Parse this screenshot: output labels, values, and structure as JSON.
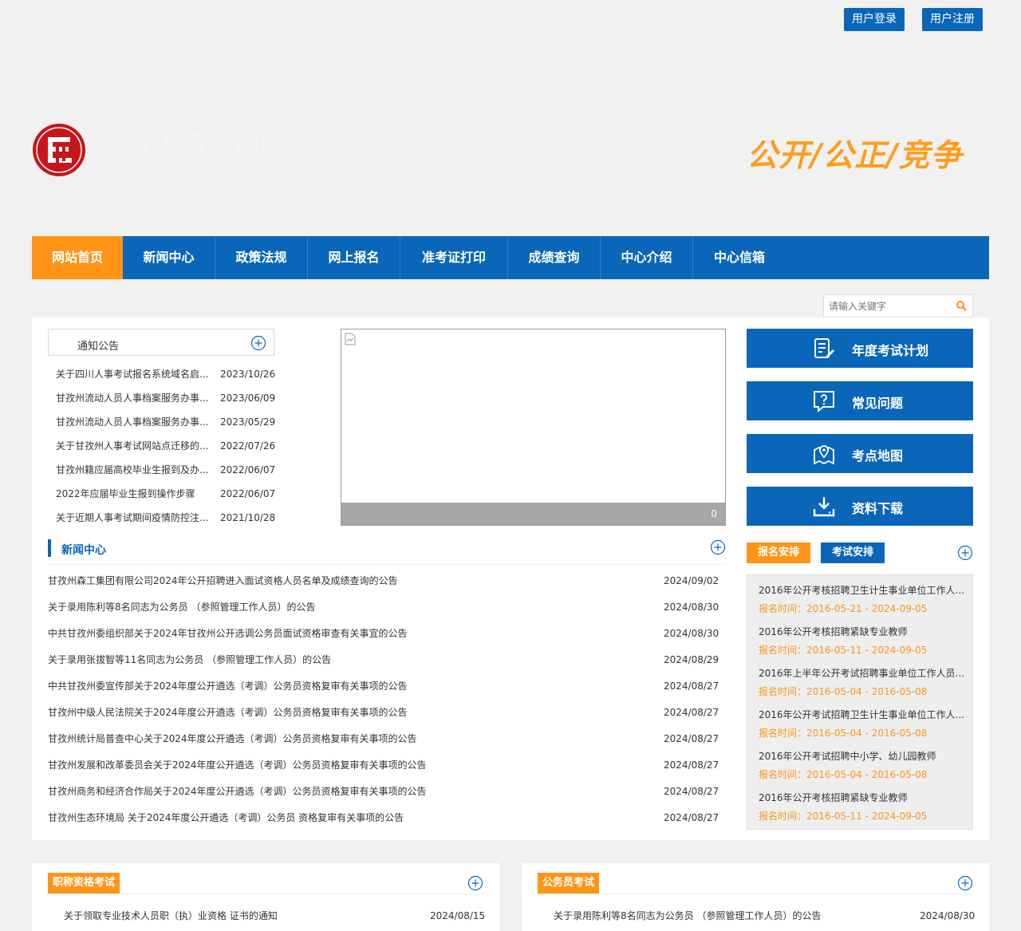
{
  "topbar": {
    "welcome": "欢迎访问甘孜人事考试网站！今天是 2024年09月06日 星期五",
    "login_label": "用户登录",
    "register_label": "用户注册"
  },
  "header": {
    "site_name": "甘孜人事考试网",
    "site_url": "http://gzzrsks.com.cn/",
    "slogan": "公开/公正/竞争",
    "logo_icon": "seal-logo-icon"
  },
  "nav": {
    "items": [
      {
        "label": "网站首页",
        "active": true
      },
      {
        "label": "新闻中心"
      },
      {
        "label": "政策法规"
      },
      {
        "label": "网上报名"
      },
      {
        "label": "准考证打印"
      },
      {
        "label": "成绩查询"
      },
      {
        "label": "中心介绍"
      },
      {
        "label": "中心信箱"
      }
    ]
  },
  "search": {
    "placeholder": "请输入关键字",
    "icon": "search-icon"
  },
  "notice": {
    "title": "通知公告",
    "items": [
      {
        "title": "关于四川人事考试报名系统域名启...",
        "date": "2023/10/26"
      },
      {
        "title": "甘孜州流动人员人事档案服务办事...",
        "date": "2023/06/09"
      },
      {
        "title": "甘孜州流动人员人事档案服务办事...",
        "date": "2023/05/29"
      },
      {
        "title": "关于甘孜州人事考试网站点迁移的...",
        "date": "2022/07/26"
      },
      {
        "title": "甘孜州籍应届高校毕业生报到及办...",
        "date": "2022/06/07"
      },
      {
        "title": "2022年应届毕业生报到操作步骤",
        "date": "2022/06/07"
      },
      {
        "title": "关于近期人事考试期间疫情防控注...",
        "date": "2021/10/28"
      }
    ]
  },
  "slider": {
    "count": "0"
  },
  "news": {
    "title": "新闻中心",
    "items": [
      {
        "title": "甘孜州森工集团有限公司2024年公开招聘进入面试资格人员名单及成绩查询的公告",
        "date": "2024/09/02"
      },
      {
        "title": "关于录用陈利等8名同志为公务员 （参照管理工作人员）的公告",
        "date": "2024/08/30"
      },
      {
        "title": "中共甘孜州委组织部关于2024年甘孜州公开选调公务员面试资格审查有关事宜的公告",
        "date": "2024/08/30"
      },
      {
        "title": "关于录用张拔智等11名同志为公务员 （参照管理工作人员）的公告",
        "date": "2024/08/29"
      },
      {
        "title": "中共甘孜州委宣传部关于2024年度公开遴选（考调）公务员资格复审有关事项的公告",
        "date": "2024/08/27"
      },
      {
        "title": "甘孜州中级人民法院关于2024年度公开遴选（考调）公务员资格复审有关事项的公告",
        "date": "2024/08/27"
      },
      {
        "title": "甘孜州统计局普查中心关于2024年度公开遴选（考调）公务员资格复审有关事项的公告",
        "date": "2024/08/27"
      },
      {
        "title": "甘孜州发展和改革委员会关于2024年度公开遴选（考调）公务员资格复审有关事项的公告",
        "date": "2024/08/27"
      },
      {
        "title": "甘孜州商务和经济合作局关于2024年度公开遴选（考调）公务员资格复审有关事项的公告",
        "date": "2024/08/27"
      },
      {
        "title": "甘孜州生态环境局 关于2024年度公开遴选（考调）公务员 资格复审有关事项的公告",
        "date": "2024/08/27"
      }
    ]
  },
  "side_buttons": [
    {
      "label": "年度考试计划",
      "icon": "plan-document-icon"
    },
    {
      "label": "常见问题",
      "icon": "question-icon"
    },
    {
      "label": "考点地图",
      "icon": "map-pin-icon"
    },
    {
      "label": "资料下载",
      "icon": "download-icon"
    }
  ],
  "schedule": {
    "tabs": [
      "报名安排",
      "考试安排"
    ],
    "items": [
      {
        "name": "2016年公开考核招聘卫生计生事业单位工作人...",
        "period": "报名时间：2016-05-21 - 2024-09-05"
      },
      {
        "name": "2016年公开考核招聘紧缺专业教师",
        "period": "报名时间：2016-05-11 - 2024-09-05"
      },
      {
        "name": "2016年上半年公开考试招聘事业单位工作人员...",
        "period": "报名时间：2016-05-04 - 2016-05-08"
      },
      {
        "name": "2016年公开考试招聘卫生计生事业单位工作人...",
        "period": "报名时间：2016-05-04 - 2016-05-08"
      },
      {
        "name": "2016年公开考试招聘中小学、幼儿园教师",
        "period": "报名时间：2016-05-04 - 2016-05-08"
      },
      {
        "name": "2016年公开考核招聘紧缺专业教师",
        "period": "报名时间：2016-05-11 - 2024-09-05"
      }
    ]
  },
  "bottom_panels": [
    {
      "tag": "职称资格考试",
      "row": {
        "title": "关于领取专业技术人员职（执）业资格 证书的通知",
        "date": "2024/08/15"
      }
    },
    {
      "tag": "公务员考试",
      "row": {
        "title": "关于录用陈利等8名同志为公务员 （参照管理工作人员）的公告",
        "date": "2024/08/30"
      }
    }
  ],
  "colors": {
    "brand_blue": "#0a66b8",
    "accent_orange": "#ff9416",
    "slogan_orange": "#ff9d1c"
  }
}
